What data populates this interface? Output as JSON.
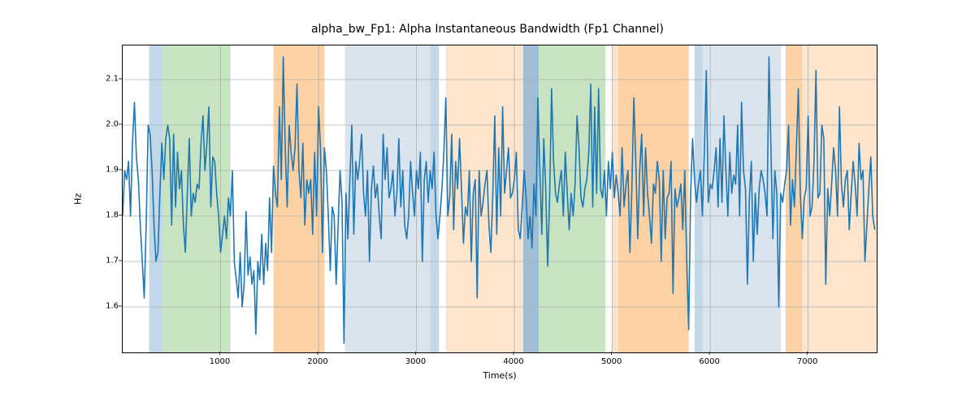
{
  "chart_data": {
    "type": "line",
    "title": "alpha_bw_Fp1: Alpha Instantaneous Bandwidth (Fp1 Channel)",
    "xlabel": "Time(s)",
    "ylabel": "Hz",
    "xlim": [
      0,
      7700
    ],
    "ylim": [
      1.5,
      2.175
    ],
    "xticks": [
      1000,
      2000,
      3000,
      4000,
      5000,
      6000,
      7000
    ],
    "yticks": [
      1.6,
      1.7,
      1.8,
      1.9,
      2.0,
      2.1
    ],
    "bands": [
      {
        "x0": 270,
        "x1": 410,
        "color": "#c2d7e8"
      },
      {
        "x0": 410,
        "x1": 1100,
        "color": "#c8e3c1"
      },
      {
        "x0": 1540,
        "x1": 2060,
        "color": "#fcd2a5"
      },
      {
        "x0": 2270,
        "x1": 3140,
        "color": "#d9e4ef"
      },
      {
        "x0": 3140,
        "x1": 3230,
        "color": "#c2d7e8"
      },
      {
        "x0": 3300,
        "x1": 4090,
        "color": "#fde4cc"
      },
      {
        "x0": 4090,
        "x1": 4250,
        "color": "#9fbed4"
      },
      {
        "x0": 4250,
        "x1": 4930,
        "color": "#c8e3c1"
      },
      {
        "x0": 5000,
        "x1": 5060,
        "color": "#fde4cc"
      },
      {
        "x0": 5060,
        "x1": 5780,
        "color": "#fcd2a5"
      },
      {
        "x0": 5840,
        "x1": 5920,
        "color": "#c2d7e8"
      },
      {
        "x0": 5920,
        "x1": 6720,
        "color": "#d9e4ef"
      },
      {
        "x0": 6770,
        "x1": 6940,
        "color": "#fcd2a5"
      },
      {
        "x0": 6940,
        "x1": 7700,
        "color": "#fde4cc"
      }
    ],
    "series": [
      {
        "name": "alpha_bw_Fp1",
        "color": "#1f77b4",
        "x_start": 0,
        "x_step": 20,
        "y": [
          1.8,
          1.9,
          1.88,
          1.92,
          1.8,
          1.96,
          2.05,
          1.93,
          1.88,
          1.78,
          1.7,
          1.62,
          1.78,
          2.0,
          1.98,
          1.9,
          1.78,
          1.7,
          1.72,
          1.85,
          1.96,
          1.88,
          1.97,
          2.0,
          1.97,
          1.78,
          1.98,
          1.82,
          1.94,
          1.86,
          1.9,
          1.78,
          1.72,
          1.85,
          1.97,
          1.8,
          1.85,
          1.83,
          1.87,
          1.86,
          1.96,
          2.02,
          1.9,
          1.96,
          2.04,
          1.82,
          1.93,
          1.92,
          1.85,
          1.8,
          1.72,
          1.76,
          1.8,
          1.75,
          1.84,
          1.8,
          1.9,
          1.7,
          1.66,
          1.62,
          1.72,
          1.6,
          1.65,
          1.81,
          1.67,
          1.71,
          1.65,
          1.68,
          1.54,
          1.7,
          1.66,
          1.76,
          1.65,
          1.74,
          1.68,
          1.84,
          1.72,
          1.91,
          1.85,
          1.82,
          2.04,
          1.88,
          2.15,
          1.95,
          1.82,
          2.0,
          1.94,
          1.9,
          1.95,
          2.09,
          1.9,
          1.84,
          1.96,
          1.78,
          1.88,
          1.85,
          1.88,
          1.76,
          1.94,
          1.8,
          2.04,
          1.95,
          1.72,
          1.95,
          1.9,
          1.8,
          1.68,
          1.82,
          1.8,
          1.65,
          1.78,
          1.9,
          1.83,
          1.52,
          1.85,
          1.75,
          1.88,
          2.0,
          1.76,
          1.92,
          1.88,
          1.92,
          1.98,
          1.85,
          1.8,
          1.9,
          1.7,
          1.86,
          1.91,
          1.84,
          1.87,
          1.8,
          1.75,
          1.98,
          1.88,
          1.95,
          1.84,
          1.86,
          1.9,
          1.8,
          1.85,
          1.97,
          1.82,
          1.9,
          1.78,
          1.75,
          1.8,
          1.92,
          1.85,
          1.8,
          1.9,
          1.86,
          1.94,
          1.7,
          1.88,
          1.92,
          1.83,
          1.9,
          1.86,
          1.94,
          1.8,
          1.75,
          1.8,
          1.86,
          1.94,
          2.06,
          1.8,
          1.84,
          1.98,
          1.77,
          1.92,
          1.86,
          1.97,
          1.86,
          1.74,
          1.82,
          1.8,
          1.9,
          1.7,
          1.85,
          1.88,
          1.62,
          1.9,
          1.8,
          1.83,
          1.87,
          1.9,
          1.78,
          1.72,
          1.85,
          2.02,
          1.76,
          1.95,
          1.8,
          2.04,
          1.85,
          1.9,
          1.95,
          1.84,
          1.85,
          1.88,
          1.94,
          1.77,
          1.75,
          1.82,
          1.9,
          1.84,
          1.75,
          1.8,
          1.73,
          1.87,
          1.8,
          2.06,
          1.9,
          1.76,
          1.97,
          1.86,
          1.69,
          1.84,
          2.08,
          1.92,
          1.85,
          1.83,
          1.87,
          1.9,
          1.8,
          1.94,
          1.85,
          1.77,
          1.85,
          1.8,
          1.87,
          2.02,
          1.95,
          1.84,
          1.82,
          1.86,
          1.88,
          1.94,
          2.09,
          1.82,
          2.04,
          1.85,
          2.08,
          1.86,
          1.84,
          1.9,
          1.8,
          1.92,
          1.86,
          1.94,
          1.84,
          1.89,
          1.85,
          1.8,
          1.95,
          1.82,
          1.87,
          1.9,
          1.72,
          1.86,
          2.06,
          1.92,
          1.75,
          1.9,
          1.98,
          1.8,
          1.95,
          1.85,
          1.8,
          1.74,
          1.87,
          1.85,
          1.92,
          1.88,
          1.7,
          1.9,
          1.75,
          1.84,
          1.85,
          1.92,
          1.63,
          1.86,
          1.82,
          1.84,
          1.87,
          1.77,
          1.9,
          1.7,
          1.55,
          1.85,
          1.97,
          1.88,
          1.83,
          1.87,
          1.9,
          1.8,
          1.94,
          2.12,
          1.83,
          1.87,
          1.86,
          1.9,
          1.95,
          1.82,
          1.97,
          1.83,
          2.02,
          1.9,
          1.8,
          1.94,
          1.85,
          1.89,
          1.87,
          2.0,
          1.8,
          2.05,
          1.9,
          1.86,
          1.65,
          1.84,
          1.92,
          1.7,
          1.85,
          1.76,
          1.86,
          1.9,
          1.88,
          1.85,
          1.8,
          2.15,
          1.95,
          1.75,
          1.9,
          1.85,
          1.6,
          1.85,
          1.83,
          1.87,
          1.9,
          2.0,
          1.78,
          1.88,
          1.82,
          1.95,
          2.08,
          1.85,
          1.75,
          1.84,
          1.86,
          2.02,
          1.8,
          1.82,
          1.92,
          2.12,
          1.84,
          1.85,
          2.0,
          1.97,
          1.65,
          1.86,
          1.8,
          1.87,
          1.95,
          1.9,
          1.8,
          2.04,
          1.87,
          1.82,
          1.88,
          1.9,
          1.77,
          1.85,
          1.92,
          1.87,
          1.8,
          1.96,
          1.88,
          1.9,
          1.7,
          1.78,
          1.86,
          1.93,
          1.8,
          1.77
        ]
      }
    ]
  }
}
